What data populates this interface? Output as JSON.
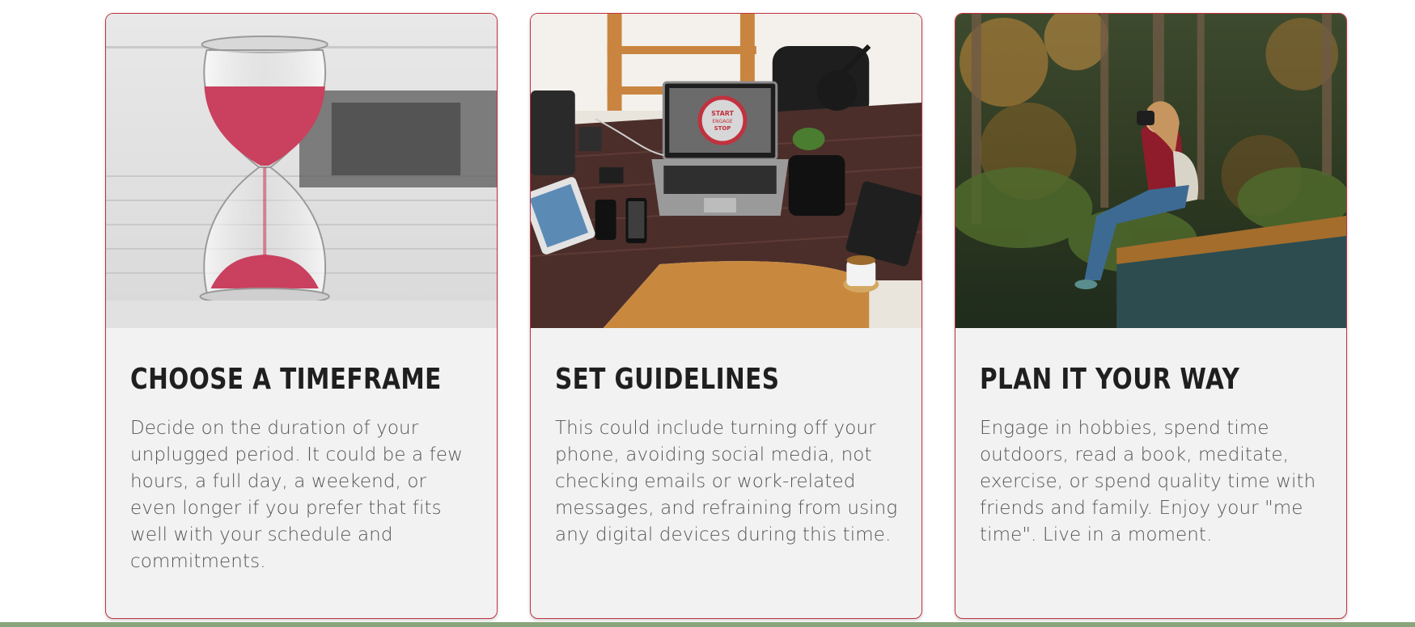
{
  "cards": [
    {
      "title": "CHOOSE A TIMEFRAME",
      "text": "Decide on the duration of your unplugged period. It could be a few hours, a full day, a weekend, or even longer if you prefer that fits well with your schedule and commitments.",
      "image_subject": "hourglass"
    },
    {
      "title": "SET GUIDELINES",
      "text": "This could include turning off your phone, avoiding social media, not checking emails or work-related messages, and refraining from using any digital devices during this time.",
      "image_subject": "desk-with-devices",
      "laptop_screen_text": [
        "START",
        "ENGAGE",
        "STOP"
      ]
    },
    {
      "title": "PLAN IT YOUR WAY",
      "text": "Engage in hobbies, spend time outdoors, read a book, meditate, exercise, or spend quality time with friends and family. Enjoy your \"me time\". Live in a moment.",
      "image_subject": "woman-photographing-in-forest"
    }
  ],
  "colors": {
    "card_border": "#c0323f",
    "card_background": "#f2f2f2",
    "title": "#1f1f1f",
    "body_text": "#555555",
    "bottom_strip": "#8aa57b"
  }
}
